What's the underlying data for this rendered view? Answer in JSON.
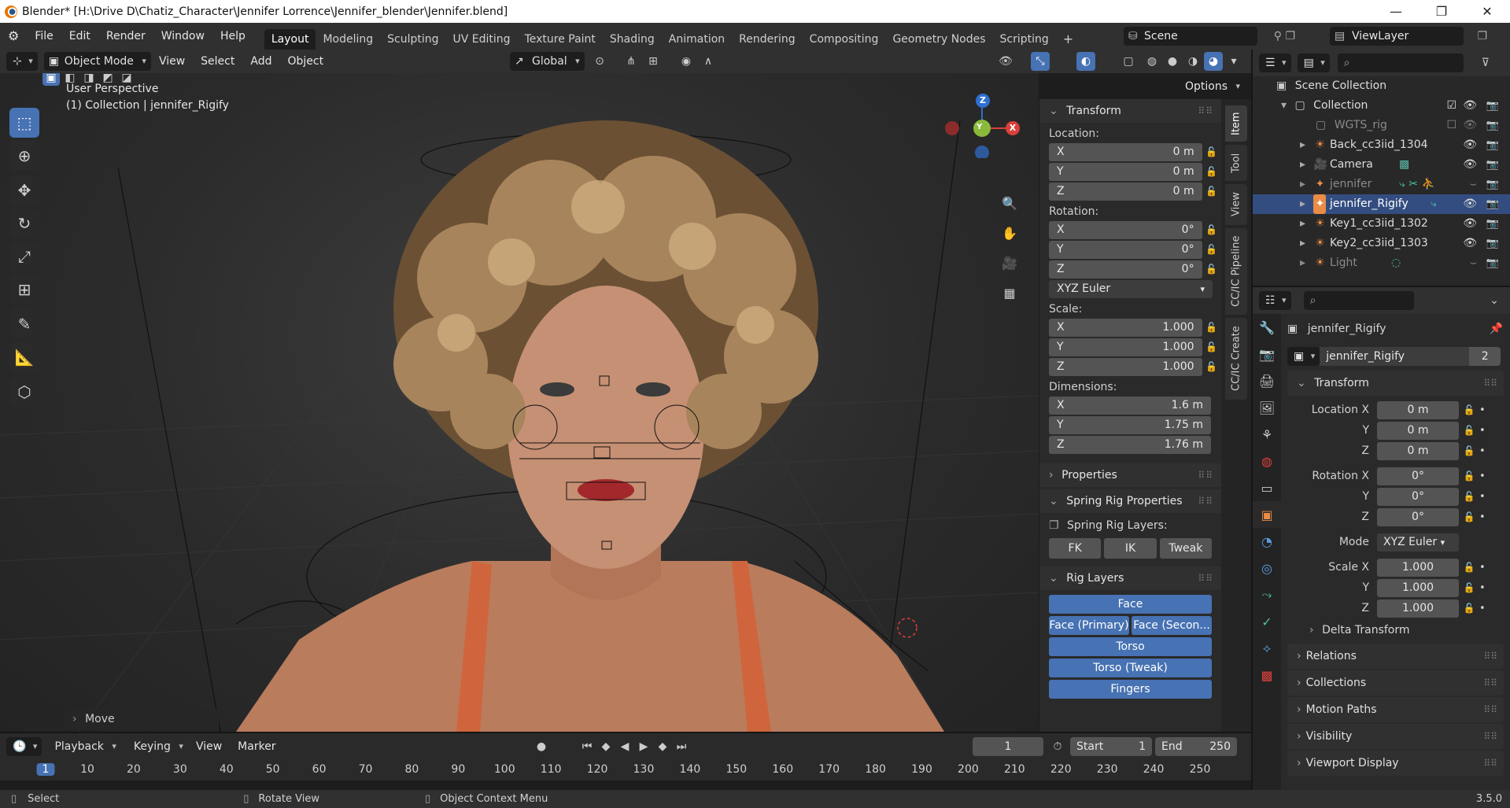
{
  "window": {
    "title": "Blender* [H:\\Drive D\\Chatiz_Character\\Jennifer Lorrence\\Jennifer_blender\\Jennifer.blend]",
    "min": "—",
    "max": "❐",
    "close": "✕"
  },
  "menus": [
    "File",
    "Edit",
    "Render",
    "Window",
    "Help"
  ],
  "workspaces": [
    "Layout",
    "Modeling",
    "Sculpting",
    "UV Editing",
    "Texture Paint",
    "Shading",
    "Animation",
    "Rendering",
    "Compositing",
    "Geometry Nodes",
    "Scripting"
  ],
  "active_workspace": "Layout",
  "scene": "Scene",
  "view_layer": "ViewLayer",
  "viewport_header": {
    "mode": "Object Mode",
    "menus": [
      "View",
      "Select",
      "Add",
      "Object"
    ],
    "orientation": "Global",
    "options": "Options"
  },
  "viewport": {
    "perspective": "User Perspective",
    "collection_info": "(1) Collection | jennifer_Rigify",
    "last_op": "Move"
  },
  "gizmo": {
    "x": "X",
    "y": "Y",
    "z": "Z"
  },
  "n_panel": {
    "tabs": [
      "Item",
      "Tool",
      "View",
      "CC/IC Pipeline",
      "CC/IC Create"
    ],
    "transform_title": "Transform",
    "location_label": "Location:",
    "location": [
      {
        "axis": "X",
        "value": "0 m"
      },
      {
        "axis": "Y",
        "value": "0 m"
      },
      {
        "axis": "Z",
        "value": "0 m"
      }
    ],
    "rotation_label": "Rotation:",
    "rotation": [
      {
        "axis": "X",
        "value": "0°"
      },
      {
        "axis": "Y",
        "value": "0°"
      },
      {
        "axis": "Z",
        "value": "0°"
      }
    ],
    "rotation_mode": "XYZ Euler",
    "scale_label": "Scale:",
    "scale": [
      {
        "axis": "X",
        "value": "1.000"
      },
      {
        "axis": "Y",
        "value": "1.000"
      },
      {
        "axis": "Z",
        "value": "1.000"
      }
    ],
    "dimensions_label": "Dimensions:",
    "dimensions": [
      {
        "axis": "X",
        "value": "1.6 m"
      },
      {
        "axis": "Y",
        "value": "1.75 m"
      },
      {
        "axis": "Z",
        "value": "1.76 m"
      }
    ],
    "properties_title": "Properties",
    "spring_title": "Spring Rig Properties",
    "spring_layers_label": "Spring Rig Layers:",
    "spring_buttons": [
      "FK",
      "IK",
      "Tweak"
    ],
    "rig_layers_title": "Rig Layers",
    "rig_face": "Face",
    "rig_face_primary": "Face (Primary)",
    "rig_face_secondary": "Face (Secon...",
    "rig_torso": "Torso",
    "rig_torso_tweak": "Torso (Tweak)",
    "rig_fingers": "Fingers"
  },
  "outliner": {
    "scene_collection": "Scene Collection",
    "collection": "Collection",
    "items": [
      {
        "name": "WGTS_rig",
        "dim": true
      },
      {
        "name": "Back_cc3iid_1304",
        "dim": false
      },
      {
        "name": "Camera",
        "dim": false
      },
      {
        "name": "jennifer",
        "dim": true
      },
      {
        "name": "jennifer_Rigify",
        "dim": false
      },
      {
        "name": "Key1_cc3iid_1302",
        "dim": false
      },
      {
        "name": "Key2_cc3iid_1303",
        "dim": false
      },
      {
        "name": "Light",
        "dim": true
      }
    ]
  },
  "properties": {
    "object_name": "jennifer_Rigify",
    "data_name": "jennifer_Rigify",
    "users": "2",
    "transform_title": "Transform",
    "location_label": "Location X",
    "location": [
      "0 m",
      "0 m",
      "0 m"
    ],
    "rotation_label": "Rotation X",
    "rotation": [
      "0°",
      "0°",
      "0°"
    ],
    "mode_label": "Mode",
    "mode_value": "XYZ Euler",
    "scale_label": "Scale X",
    "scale": [
      "1.000",
      "1.000",
      "1.000"
    ],
    "y_label": "Y",
    "z_label": "Z",
    "delta": "Delta Transform",
    "sections": [
      "Relations",
      "Collections",
      "Motion Paths",
      "Visibility",
      "Viewport Display"
    ]
  },
  "timeline": {
    "menus": [
      "Playback",
      "Keying",
      "View",
      "Marker"
    ],
    "current_frame": "1",
    "start_label": "Start",
    "start": "1",
    "end_label": "End",
    "end": "250",
    "ticks": [
      "1",
      "10",
      "20",
      "30",
      "40",
      "50",
      "60",
      "70",
      "80",
      "90",
      "100",
      "110",
      "120",
      "130",
      "140",
      "150",
      "160",
      "170",
      "180",
      "190",
      "200",
      "210",
      "220",
      "230",
      "240",
      "250"
    ]
  },
  "statusbar": {
    "select": "Select",
    "rotate": "Rotate View",
    "context": "Object Context Menu",
    "version": "3.5.0"
  }
}
